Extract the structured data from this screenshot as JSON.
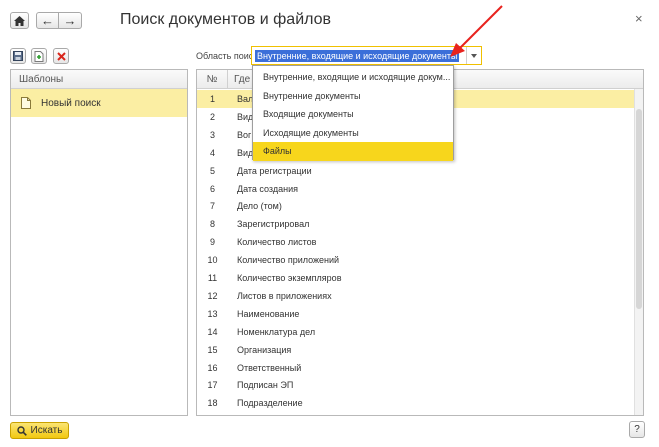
{
  "window": {
    "title": "Поиск документов и файлов",
    "close_glyph": "×"
  },
  "nav": {
    "home_icon": "home-icon",
    "back_glyph": "←",
    "forward_glyph": "→"
  },
  "templates": {
    "header": "Шаблоны",
    "items": [
      {
        "label": "Новый поиск"
      }
    ]
  },
  "search_area": {
    "label": "Область поиска:",
    "value": "Внутренние, входящие и исходящие документы",
    "options": [
      "Внутренние, входящие и исходящие докум...",
      "Внутренние документы",
      "Входящие документы",
      "Исходящие документы",
      "Файлы"
    ],
    "highlighted_index": 4
  },
  "grid": {
    "col_number": "№",
    "col_field": "Где",
    "rows": [
      {
        "n": "1",
        "f": "Вал"
      },
      {
        "n": "2",
        "f": "Вид"
      },
      {
        "n": "3",
        "f": "Вог"
      },
      {
        "n": "4",
        "f": "Вид"
      },
      {
        "n": "5",
        "f": "Дата регистрации"
      },
      {
        "n": "6",
        "f": "Дата создания"
      },
      {
        "n": "7",
        "f": "Дело (том)"
      },
      {
        "n": "8",
        "f": "Зарегистрировал"
      },
      {
        "n": "9",
        "f": "Количество листов"
      },
      {
        "n": "10",
        "f": "Количество приложений"
      },
      {
        "n": "11",
        "f": "Количество экземпляров"
      },
      {
        "n": "12",
        "f": "Листов в приложениях"
      },
      {
        "n": "13",
        "f": "Наименование"
      },
      {
        "n": "14",
        "f": "Номенклатура дел"
      },
      {
        "n": "15",
        "f": "Организация"
      },
      {
        "n": "16",
        "f": "Ответственный"
      },
      {
        "n": "17",
        "f": "Подписан ЭП"
      },
      {
        "n": "18",
        "f": "Подразделение"
      }
    ],
    "selected_row_index": 0
  },
  "footer": {
    "find_label": "Искать",
    "help_label": "?"
  },
  "colors": {
    "accent_yellow": "#f7d61c",
    "selection_yellow": "#fbeea3",
    "arrow_red": "#e8231e"
  }
}
